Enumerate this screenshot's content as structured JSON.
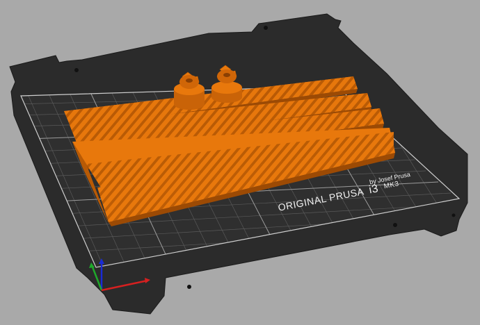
{
  "scene": {
    "background_color": "#a9a9a9",
    "bed_color": "#2b2b2b",
    "model_color": "#e8780c"
  },
  "bed": {
    "logo_main": "ORIGINAL PRUSA",
    "logo_model": "i3",
    "logo_version": "MK3",
    "logo_byline": "by Josef Prusa"
  },
  "objects": {
    "gears": [
      "gear",
      "gear"
    ],
    "racks": [
      "rack",
      "rack",
      "rack",
      "rack"
    ]
  },
  "axes": [
    "x-axis",
    "y-axis",
    "z-axis"
  ]
}
